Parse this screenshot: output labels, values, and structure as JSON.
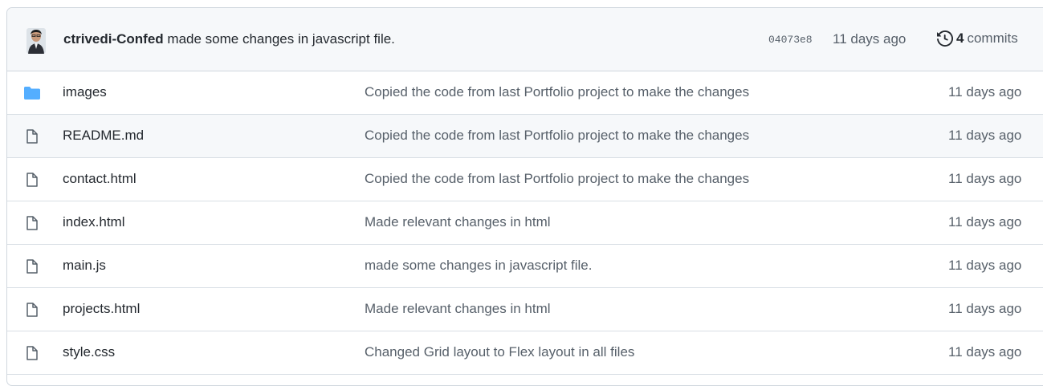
{
  "latest_commit": {
    "author": "ctrivedi-Confed",
    "message": "made some changes in javascript file.",
    "sha": "04073e8",
    "age": "11 days ago",
    "history_icon": "history-icon",
    "commit_count": "4",
    "commit_label": "commits"
  },
  "files": [
    {
      "type": "folder",
      "icon": "folder-icon",
      "name": "images",
      "commit": "Copied the code from last Portfolio project to make the changes",
      "age": "11 days ago"
    },
    {
      "type": "file",
      "icon": "file-icon",
      "name": "README.md",
      "commit": "Copied the code from last Portfolio project to make the changes",
      "age": "11 days ago"
    },
    {
      "type": "file",
      "icon": "file-icon",
      "name": "contact.html",
      "commit": "Copied the code from last Portfolio project to make the changes",
      "age": "11 days ago"
    },
    {
      "type": "file",
      "icon": "file-icon",
      "name": "index.html",
      "commit": "Made relevant changes in html",
      "age": "11 days ago"
    },
    {
      "type": "file",
      "icon": "file-icon",
      "name": "main.js",
      "commit": "made some changes in javascript file.",
      "age": "11 days ago"
    },
    {
      "type": "file",
      "icon": "file-icon",
      "name": "projects.html",
      "commit": "Made relevant changes in html",
      "age": "11 days ago"
    },
    {
      "type": "file",
      "icon": "file-icon",
      "name": "style.css",
      "commit": "Changed Grid layout to Flex layout in all files",
      "age": "11 days ago"
    }
  ],
  "colors": {
    "folder": "#54aeff",
    "text": "#24292f",
    "muted": "#57606a",
    "header_bg": "#f6f8fa",
    "border": "#d0d7de"
  }
}
